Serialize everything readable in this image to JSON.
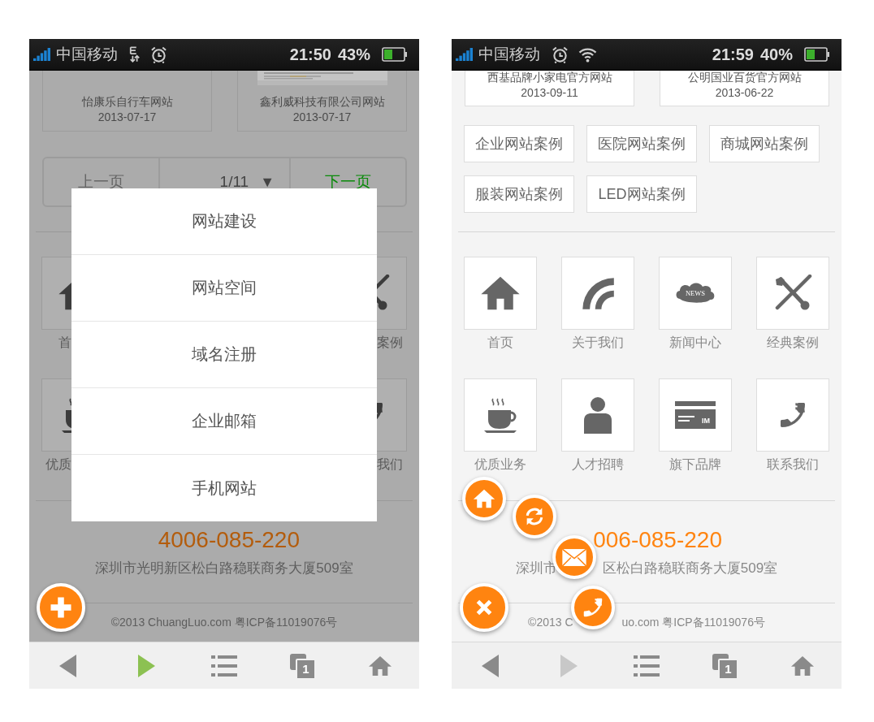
{
  "phones": [
    {
      "status_bar": {
        "carrier": "中国移动",
        "icons": [
          {
            "kind": "data"
          },
          {
            "kind": "alarm"
          }
        ],
        "time": "21:50",
        "battery": "43%"
      },
      "dimmed": true,
      "cases": [
        {
          "title": "怡康乐自行车网站",
          "date": "2013-07-17",
          "thumbnail": false
        },
        {
          "title": "鑫利威科技有限公司网站",
          "date": "2013-07-17",
          "thumbnail": true
        }
      ],
      "pagination": {
        "prev": "上一页",
        "page": "1/11",
        "caret": "▼",
        "next": "下一页"
      },
      "tiles": [
        {
          "kind": "home",
          "label": "首"
        },
        {
          "kind": "tools",
          "label": "案例"
        },
        {
          "kind": "cup",
          "label": "优质"
        },
        {
          "kind": "phone",
          "label": "我们"
        }
      ],
      "footer": {
        "phone": "4006-085-220",
        "address": [
          "深圳市光明新区松白路稳联商务大厦509室"
        ],
        "copyright": [
          "©2013 ChuangLuo.com 粤ICP备11019076号"
        ]
      },
      "nav": [
        {
          "kind": "back"
        },
        {
          "kind": "forward",
          "disabled": false
        },
        {
          "kind": "list"
        },
        {
          "kind": "tabs",
          "count": "1"
        },
        {
          "kind": "home"
        }
      ],
      "menu": [
        "网站建设",
        "网站空间",
        "域名注册",
        "企业邮箱",
        "手机网站"
      ],
      "fabs": [
        {
          "kind": "plus"
        }
      ]
    },
    {
      "status_bar": {
        "carrier": "中国移动",
        "icons": [
          {
            "kind": "alarm"
          },
          {
            "kind": "wifi"
          }
        ],
        "time": "21:59",
        "battery": "40%"
      },
      "dimmed": false,
      "cases": [
        {
          "title": "西基品牌小家电官方网站",
          "date": "2013-09-11",
          "thumbnail": false
        },
        {
          "title": "公明国业百货官方网站",
          "date": "2013-06-22",
          "thumbnail": false
        }
      ],
      "categories": [
        "企业网站案例",
        "医院网站案例",
        "商城网站案例",
        "服装网站案例",
        "LED网站案例"
      ],
      "tiles": [
        {
          "kind": "home",
          "label": "首页"
        },
        {
          "kind": "arcs",
          "label": "关于我们"
        },
        {
          "kind": "news",
          "icon_text": "NEWS",
          "label": "新闻中心"
        },
        {
          "kind": "tools",
          "label": "经典案例"
        },
        {
          "kind": "cup",
          "label": "优质业务"
        },
        {
          "kind": "person",
          "label": "人才招聘"
        },
        {
          "kind": "card",
          "icon_text": "IM",
          "label": "旗下品牌"
        },
        {
          "kind": "phone",
          "label": "联系我们"
        }
      ],
      "footer": {
        "phone": "006-085-220",
        "address": [
          "深圳市",
          "区松白路稳联商务大厦509室"
        ],
        "copyright": [
          "©2013 C",
          "uo.com 粤ICP备11019076号"
        ]
      },
      "nav": [
        {
          "kind": "back"
        },
        {
          "kind": "forward",
          "disabled": true
        },
        {
          "kind": "list"
        },
        {
          "kind": "tabs",
          "count": "1"
        },
        {
          "kind": "home"
        }
      ],
      "fabs": [
        {
          "kind": "home"
        },
        {
          "kind": "refresh"
        },
        {
          "kind": "mail"
        },
        {
          "kind": "close"
        },
        {
          "kind": "phone"
        }
      ]
    }
  ]
}
